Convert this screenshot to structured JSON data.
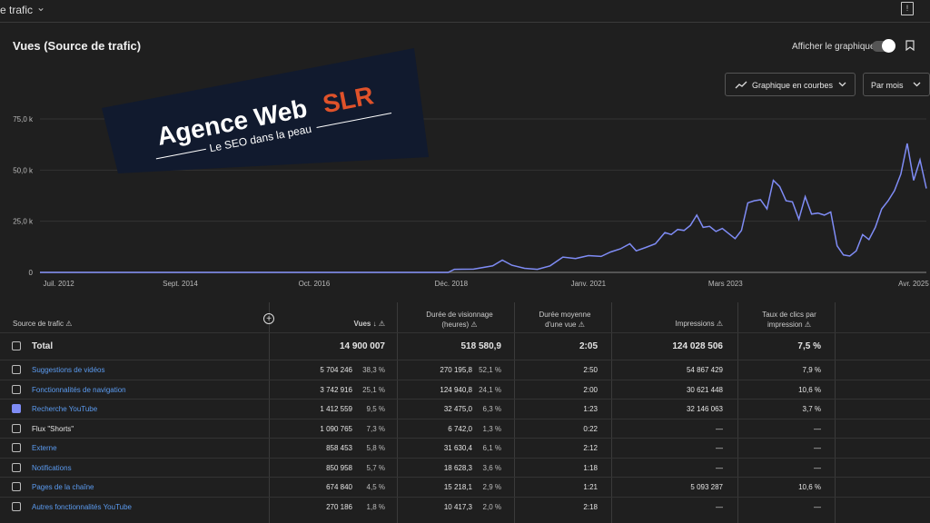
{
  "topbar": {
    "title": "e trafic",
    "chevron": "⌄",
    "feedback": "!"
  },
  "chart_header": {
    "title": "Vues (Source de trafic)",
    "toggle_label": "Afficher le graphique"
  },
  "controls": {
    "chart_type": "Graphique en courbes",
    "period": "Par mois"
  },
  "chart_data": {
    "type": "line",
    "y_ticks": [
      "75,0 k",
      "50,0 k",
      "25,0 k",
      "0"
    ],
    "x_ticks": [
      "Juil. 2012",
      "Sept. 2014",
      "Oct. 2016",
      "Déc. 2018",
      "Janv. 2021",
      "Mars 2023",
      "Avr. 2025"
    ],
    "ylim": [
      0,
      75000
    ],
    "color": "#7f8cf5",
    "points": [
      [
        2012.5,
        0
      ],
      [
        2018.9,
        0
      ],
      [
        2019.0,
        1500
      ],
      [
        2019.3,
        1600
      ],
      [
        2019.6,
        3200
      ],
      [
        2019.75,
        6000
      ],
      [
        2019.9,
        3500
      ],
      [
        2020.1,
        2000
      ],
      [
        2020.3,
        1500
      ],
      [
        2020.5,
        3200
      ],
      [
        2020.7,
        7500
      ],
      [
        2020.9,
        6800
      ],
      [
        2021.1,
        8200
      ],
      [
        2021.3,
        7800
      ],
      [
        2021.45,
        10000
      ],
      [
        2021.6,
        11500
      ],
      [
        2021.75,
        14000
      ],
      [
        2021.85,
        10500
      ],
      [
        2022.0,
        12200
      ],
      [
        2022.15,
        14000
      ],
      [
        2022.3,
        19500
      ],
      [
        2022.4,
        18500
      ],
      [
        2022.5,
        21000
      ],
      [
        2022.6,
        20500
      ],
      [
        2022.7,
        23000
      ],
      [
        2022.8,
        28000
      ],
      [
        2022.9,
        22000
      ],
      [
        2023.0,
        22500
      ],
      [
        2023.1,
        20000
      ],
      [
        2023.2,
        21500
      ],
      [
        2023.3,
        19000
      ],
      [
        2023.4,
        16500
      ],
      [
        2023.5,
        20500
      ],
      [
        2023.6,
        34000
      ],
      [
        2023.7,
        35000
      ],
      [
        2023.8,
        35500
      ],
      [
        2023.9,
        31000
      ],
      [
        2024.0,
        45000
      ],
      [
        2024.1,
        42000
      ],
      [
        2024.2,
        35000
      ],
      [
        2024.3,
        34500
      ],
      [
        2024.4,
        26000
      ],
      [
        2024.5,
        37000
      ],
      [
        2024.6,
        28500
      ],
      [
        2024.7,
        29000
      ],
      [
        2024.8,
        28000
      ],
      [
        2024.9,
        29500
      ],
      [
        2025.0,
        13000
      ],
      [
        2025.1,
        8500
      ],
      [
        2025.2,
        8000
      ],
      [
        2025.3,
        10500
      ],
      [
        2025.4,
        18500
      ],
      [
        2025.5,
        16000
      ],
      [
        2025.6,
        22000
      ],
      [
        2025.7,
        31000
      ],
      [
        2025.8,
        35000
      ],
      [
        2025.9,
        40000
      ],
      [
        2026.0,
        48000
      ],
      [
        2026.1,
        63000
      ],
      [
        2026.2,
        45000
      ],
      [
        2026.3,
        55000
      ],
      [
        2026.4,
        41000
      ]
    ]
  },
  "table": {
    "headers": {
      "source": "Source de trafic",
      "views": "Vues",
      "watch": "Durée de visionnage (heures)",
      "avg": "Durée moyenne d'une vue",
      "impr": "Impressions",
      "ctr": "Taux de clics par impression"
    },
    "total": {
      "label": "Total",
      "views": "14 900 007",
      "watch": "518 580,9",
      "avg": "2:05",
      "impr": "124 028 506",
      "ctr": "7,5 %"
    },
    "rows": [
      {
        "label": "Suggestions de vidéos",
        "link": true,
        "checked": false,
        "views": "5 704 246",
        "views_pct": "38,3 %",
        "watch": "270 195,8",
        "watch_pct": "52,1 %",
        "avg": "2:50",
        "impr": "54 867 429",
        "ctr": "7,9 %"
      },
      {
        "label": "Fonctionnalités de navigation",
        "link": true,
        "checked": false,
        "views": "3 742 916",
        "views_pct": "25,1 %",
        "watch": "124 940,8",
        "watch_pct": "24,1 %",
        "avg": "2:00",
        "impr": "30 621 448",
        "ctr": "10,6 %"
      },
      {
        "label": "Recherche YouTube",
        "link": true,
        "checked": true,
        "views": "1 412 559",
        "views_pct": "9,5 %",
        "watch": "32 475,0",
        "watch_pct": "6,3 %",
        "avg": "1:23",
        "impr": "32 146 063",
        "ctr": "3,7 %"
      },
      {
        "label": "Flux \"Shorts\"",
        "link": false,
        "checked": false,
        "views": "1 090 765",
        "views_pct": "7,3 %",
        "watch": "6 742,0",
        "watch_pct": "1,3 %",
        "avg": "0:22",
        "impr": "—",
        "ctr": "—"
      },
      {
        "label": "Externe",
        "link": true,
        "checked": false,
        "views": "858 453",
        "views_pct": "5,8 %",
        "watch": "31 630,4",
        "watch_pct": "6,1 %",
        "avg": "2:12",
        "impr": "—",
        "ctr": "—"
      },
      {
        "label": "Notifications",
        "link": true,
        "checked": false,
        "views": "850 958",
        "views_pct": "5,7 %",
        "watch": "18 628,3",
        "watch_pct": "3,6 %",
        "avg": "1:18",
        "impr": "—",
        "ctr": "—"
      },
      {
        "label": "Pages de la chaîne",
        "link": true,
        "checked": false,
        "views": "674 840",
        "views_pct": "4,5 %",
        "watch": "15 218,1",
        "watch_pct": "2,9 %",
        "avg": "1:21",
        "impr": "5 093 287",
        "ctr": "10,6 %"
      },
      {
        "label": "Autres fonctionnalités YouTube",
        "link": true,
        "checked": false,
        "views": "270 186",
        "views_pct": "1,8 %",
        "watch": "10 417,3",
        "watch_pct": "2,0 %",
        "avg": "2:18",
        "impr": "—",
        "ctr": "—"
      }
    ]
  },
  "logo": {
    "name": "Agence Web",
    "accent": "SLR",
    "tagline": "Le SEO dans la peau",
    "bg": "#111a2e",
    "accent_color": "#e0522a"
  }
}
